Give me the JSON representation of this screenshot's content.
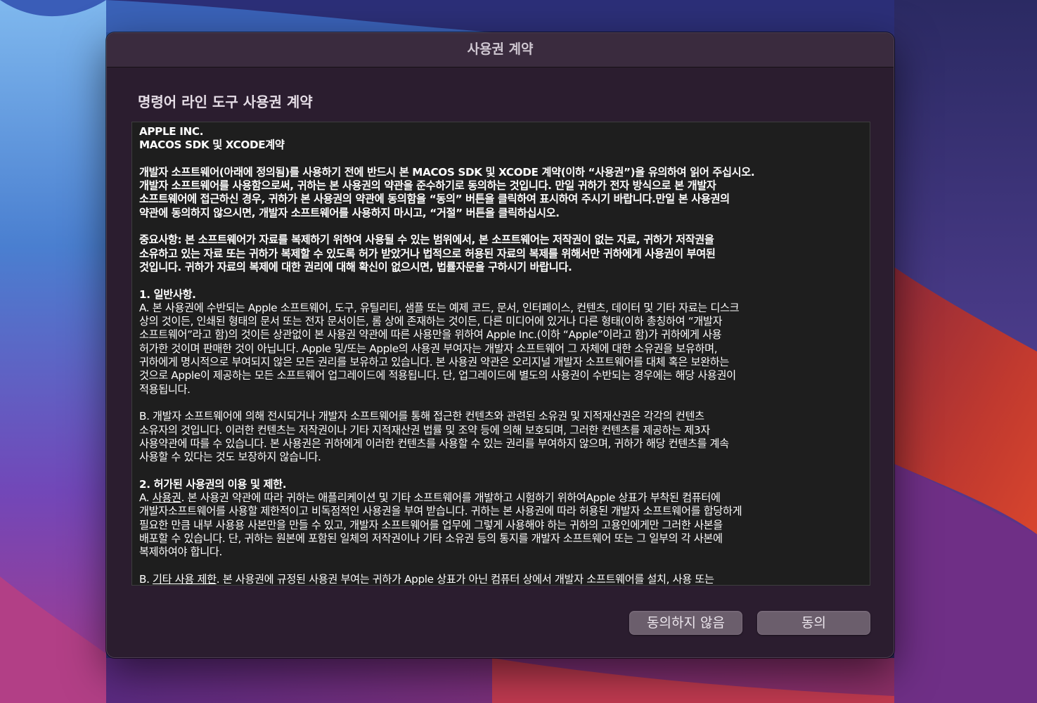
{
  "window": {
    "title": "사용권 계약"
  },
  "agreement": {
    "heading": "명령어 라인 도구 사용권 계약",
    "lines": [
      {
        "text": "APPLE INC.",
        "bold": true
      },
      {
        "text": "MACOS SDK 및 XCODE계약",
        "bold": true
      },
      {
        "text": "",
        "blank": true
      },
      {
        "text": "개발자 소프트웨어(아래에 정의됨)를 사용하기 전에 반드시 본 MACOS SDK 및 XCODE  계약(이하 “사용권”)을 유의하여 읽어 주십시오.",
        "bold": true
      },
      {
        "text": "개발자 소프트웨어를 사용함으로써, 귀하는 본 사용권의 약관을 준수하기로 동의하는 것입니다. 만일 귀하가 전자 방식으로 본 개발자",
        "bold": true
      },
      {
        "text": "소프트웨어에 접근하신 경우, 귀하가 본 사용권의 약관에 동의함을 “동의” 버튼을 클릭하여 표시하여 주시기 바랍니다.만일 본 사용권의",
        "bold": true
      },
      {
        "text": "약관에 동의하지 않으시면, 개발자 소프트웨어를 사용하지 마시고, “거절” 버튼을 클릭하십시오.",
        "bold": true
      },
      {
        "text": "",
        "blank": true
      },
      {
        "text": "중요사항:  본 소프트웨어가 자료를 복제하기 위하여 사용될 수 있는 범위에서, 본 소프트웨어는 저작권이 없는 자료, 귀하가 저작권을",
        "bold": true
      },
      {
        "text": "소유하고 있는 자료 또는 귀하가 복제할 수 있도록 허가 받았거나 법적으로 허용된 자료의 복제를 위해서만 귀하에게 사용권이 부여된",
        "bold": true
      },
      {
        "text": "것입니다. 귀하가 자료의 복제에 대한 권리에 대해 확신이 없으시면, 법률자문을 구하시기 바랍니다.",
        "bold": true
      },
      {
        "text": "",
        "blank": true
      },
      {
        "text": "1. 일반사항.",
        "bold": true
      },
      {
        "text": "A. 본 사용권에 수반되는 Apple 소프트웨어, 도구, 유틸리티, 샘플 또는 예제 코드, 문서, 인터페이스, 컨텐츠, 데이터 및 기타 자료는 디스크"
      },
      {
        "text": "상의 것이든, 인쇄된 형태의 문서 또는 전자 문서이든, 롬 상에 존재하는 것이든, 다른 미디어에 있거나 다른 형태(이하 총칭하여 “개발자"
      },
      {
        "text": "소프트웨어”라고 함)의 것이든 상관없이 본 사용권 약관에 따른 사용만을 위하여 Apple Inc.(이하 “Apple”이라고 함)가 귀하에게 사용"
      },
      {
        "text": "허가한 것이며 판매한 것이 아닙니다. Apple 및/또는 Apple의 사용권 부여자는 개발자 소프트웨어 그 자체에 대한 소유권을 보유하며,"
      },
      {
        "text": "귀하에게 명시적으로 부여되지 않은 모든 권리를 보유하고 있습니다. 본 사용권 약관은 오리지널 개발자 소프트웨어를 대체 혹은 보완하는"
      },
      {
        "text": "것으로 Apple이 제공하는 모든 소프트웨어 업그레이드에 적용됩니다. 단, 업그레이드에 별도의 사용권이 수반되는 경우에는 해당 사용권이"
      },
      {
        "text": "적용됩니다."
      },
      {
        "text": "",
        "blank": true
      },
      {
        "text": "B. 개발자 소프트웨어에 의해 전시되거나 개발자 소프트웨어를 통해 접근한 컨텐츠와 관련된 소유권 및 지적재산권은 각각의 컨텐츠"
      },
      {
        "text": "소유자의 것입니다. 이러한 컨텐츠는 저작권이나 기타 지적재산권 법률 및 조약 등에 의해 보호되며, 그러한 컨텐츠를 제공하는 제3자"
      },
      {
        "text": "사용약관에 따를 수 있습니다. 본 사용권은 귀하에게 이러한 컨텐츠를 사용할 수 있는 권리를 부여하지 않으며, 귀하가 해당 컨텐츠를 계속"
      },
      {
        "text": "사용할 수 있다는 것도 보장하지 않습니다."
      },
      {
        "text": "",
        "blank": true
      },
      {
        "text": "2. 허가된 사용권의 이용 및 제한.",
        "bold": true
      },
      {
        "prefix": "A. ",
        "underline": "사용권",
        "text": ". 본 사용권 약관에 따라 귀하는 애플리케이션 및 기타 소프트웨어를 개발하고 시험하기 위하여Apple 상표가 부착된 컴퓨터에"
      },
      {
        "text": "개발자소프트웨어를 사용할 제한적이고 비독점적인 사용권을 부여 받습니다. 귀하는 본 사용권에 따라 허용된 개발자 소프트웨어를 합당하게"
      },
      {
        "text": "필요한 만큼 내부 사용용 사본만을 만들 수 있고, 개발자 소프트웨어를 업무에 그렇게 사용해야 하는 귀하의 고용인에게만 그러한 사본을"
      },
      {
        "text": "배포할 수 있습니다. 단, 귀하는 원본에 포함된 일체의 저작권이나 기타 소유권 등의 통지를 개발자 소프트웨어 또는 그 일부의 각 사본에"
      },
      {
        "text": "복제하여야 합니다."
      },
      {
        "text": "",
        "blank": true
      },
      {
        "prefix": "B. ",
        "underline": "기타 사용 제한",
        "text": ". 본 사용권에 규정된 사용권 부여는 귀하가 Apple 상표가 아닌 컴퓨터 상에서  개발자 소프트웨어를 설치, 사용 또는"
      }
    ]
  },
  "buttons": {
    "decline_label": "동의하지 않음",
    "agree_label": "동의"
  }
}
